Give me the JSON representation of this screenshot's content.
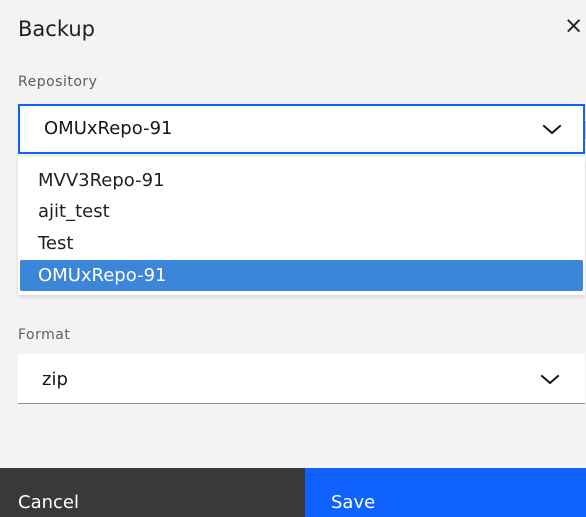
{
  "dialog": {
    "title": "Backup",
    "close_icon": "close-icon",
    "close_glyph": "×"
  },
  "repository": {
    "label": "Repository",
    "selected_value": "OMUxRepo-91",
    "options": [
      {
        "label": "MVV3Repo-91"
      },
      {
        "label": "ajit_test"
      },
      {
        "label": "Test"
      },
      {
        "label": "OMUxRepo-91",
        "selected": true
      }
    ],
    "chevron_icon": "chevron-down-icon"
  },
  "format": {
    "label": "Format",
    "selected_value": "zip",
    "chevron_icon": "chevron-down-icon"
  },
  "footer": {
    "cancel_label": "Cancel",
    "save_label": "Save"
  },
  "colors": {
    "primary": "#0f62fe",
    "secondary_button": "#393939",
    "dropdown_selection": "#3b86d8",
    "background": "#f3f3f3",
    "field_background": "#ffffff"
  }
}
